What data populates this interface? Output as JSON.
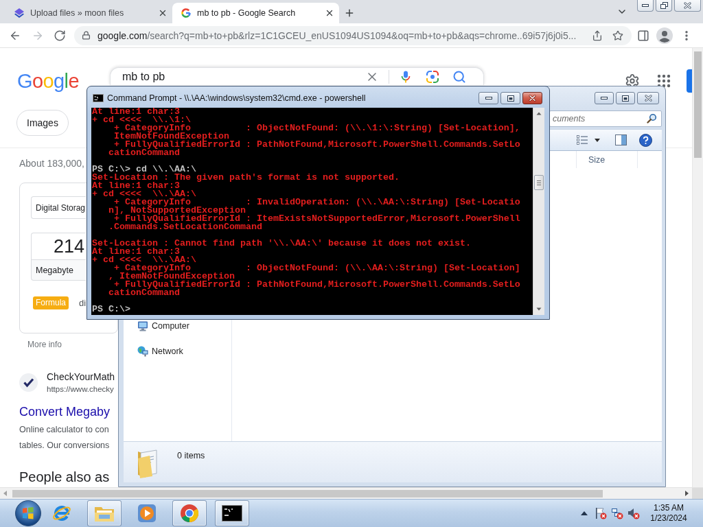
{
  "browser": {
    "tabs": [
      {
        "title": "Upload files » moon files",
        "selected": false,
        "kind": "upload"
      },
      {
        "title": "mb to pb - Google Search",
        "selected": true,
        "kind": "search"
      }
    ],
    "back": {
      "disabled": false
    },
    "forward": {
      "disabled": true
    },
    "address": {
      "host": "google.com",
      "path": "/search?q=mb+to+pb&rlz=1C1GCEU_enUS1094US1094&oq=mb+to+pb&aqs=chrome..69i57j6j0i5..."
    }
  },
  "search_page": {
    "logo": "Google",
    "query": "mb to pb",
    "filters": [
      {
        "label": "Images"
      }
    ],
    "result_stats": "About 183,000,",
    "converter": {
      "unit_type": "Digital Storag",
      "value": "214",
      "unit": "Megabyte",
      "formula_badge": "Formula",
      "formula_text": "di"
    },
    "more_info": "More info",
    "result": {
      "site": "CheckYourMath",
      "url": "https://www.checky",
      "title": "Convert Megaby",
      "snippet": [
        "Online calculator to con",
        "tables. Our conversions"
      ]
    },
    "section_heading": "People also as"
  },
  "console_window": {
    "active": true,
    "title": "Command Prompt - \\\\.\\AA:\\windows\\system32\\cmd.exe - powershell",
    "lines": [
      {
        "kind": "error",
        "text": "At line:1 char:3"
      },
      {
        "kind": "error",
        "text": "+ cd <<<<  \\\\.\\1:\\"
      },
      {
        "kind": "error",
        "text": "    + CategoryInfo          : ObjectNotFound: (\\\\.\\1:\\:String) [Set-Location],"
      },
      {
        "kind": "error",
        "text": "    ItemNotFoundException"
      },
      {
        "kind": "error",
        "text": "    + FullyQualifiedErrorId : PathNotFound,Microsoft.PowerShell.Commands.SetLo"
      },
      {
        "kind": "error",
        "text": "   cationCommand"
      },
      {
        "kind": "blank"
      },
      {
        "kind": "prompt",
        "text": "PS C:\\> cd \\\\.\\AA:\\"
      },
      {
        "kind": "error",
        "text": "Set-Location : The given path's format is not supported."
      },
      {
        "kind": "error",
        "text": "At line:1 char:3"
      },
      {
        "kind": "error",
        "text": "+ cd <<<<  \\\\.\\AA:\\"
      },
      {
        "kind": "error",
        "text": "    + CategoryInfo          : InvalidOperation: (\\\\.\\AA:\\:String) [Set-Locatio"
      },
      {
        "kind": "error",
        "text": "   n], NotSupportedException"
      },
      {
        "kind": "error",
        "text": "    + FullyQualifiedErrorId : ItemExistsNotSupportedError,Microsoft.PowerShell"
      },
      {
        "kind": "error",
        "text": "   .Commands.SetLocationCommand"
      },
      {
        "kind": "blank"
      },
      {
        "kind": "error",
        "text": "Set-Location : Cannot find path '\\\\.\\AA:\\' because it does not exist."
      },
      {
        "kind": "error",
        "text": "At line:1 char:3"
      },
      {
        "kind": "error",
        "text": "+ cd <<<<  \\\\.\\AA:\\"
      },
      {
        "kind": "error",
        "text": "    + CategoryInfo          : ObjectNotFound: (\\\\.\\AA:\\:String) [Set-Location]"
      },
      {
        "kind": "error",
        "text": "   , ItemNotFoundException"
      },
      {
        "kind": "error",
        "text": "    + FullyQualifiedErrorId : PathNotFound,Microsoft.PowerShell.Commands.SetLo"
      },
      {
        "kind": "error",
        "text": "   cationCommand"
      },
      {
        "kind": "blank"
      },
      {
        "kind": "prompt",
        "text": "PS C:\\>"
      }
    ]
  },
  "explorer_window": {
    "active": false,
    "search": {
      "placeholder": "cuments"
    },
    "columns": [
      "Size"
    ],
    "nav_items": [
      {
        "label": "Computer",
        "kind": "computer"
      },
      {
        "label": "Network",
        "kind": "network"
      }
    ],
    "status": "0 items"
  },
  "taskbar": {
    "apps": [
      {
        "kind": "ie",
        "open": false
      },
      {
        "kind": "explorer",
        "open": true
      },
      {
        "kind": "media",
        "open": false
      },
      {
        "kind": "chrome",
        "open": true
      },
      {
        "kind": "terminal",
        "open": true
      }
    ],
    "time": "1:35 AM",
    "date": "1/23/2024"
  }
}
